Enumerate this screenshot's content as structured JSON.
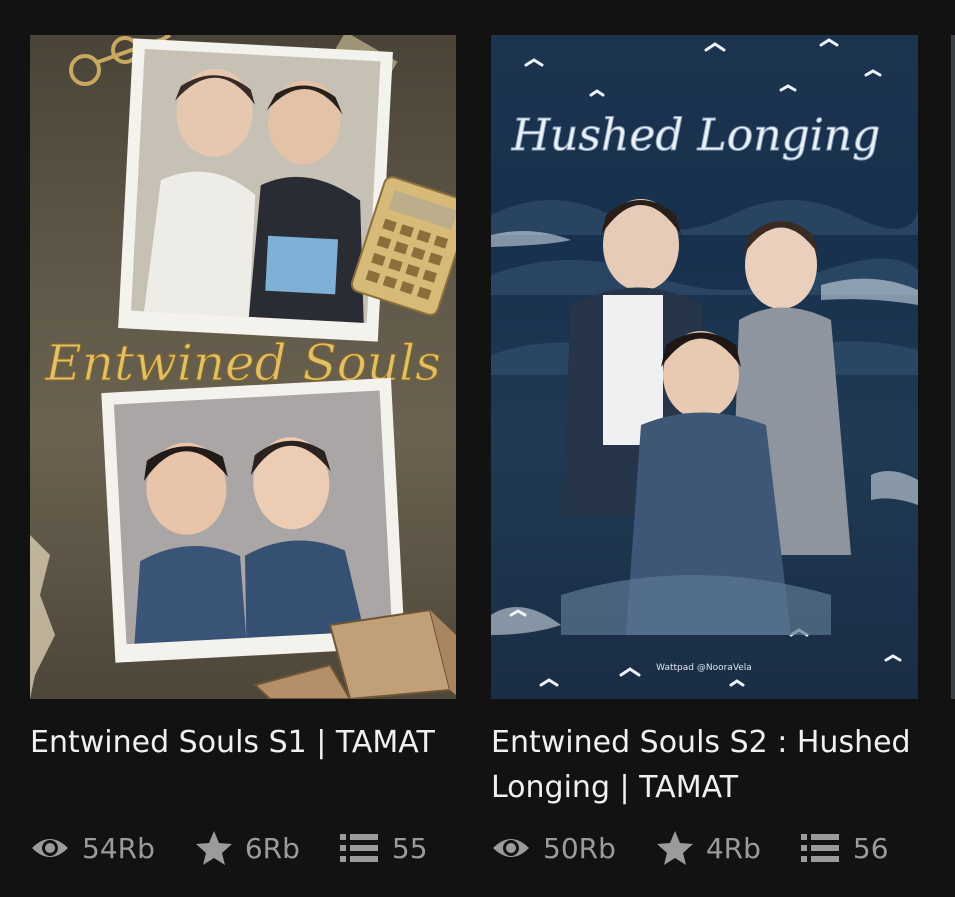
{
  "stories": [
    {
      "cover_lettering": "Entwined Souls",
      "title": "Entwined Souls S1 | TAMAT",
      "reads": "54Rb",
      "votes": "6Rb",
      "parts": "55"
    },
    {
      "cover_lettering": "Hushed Longing",
      "cover_credit": "Wattpad @NooraVela",
      "title": "Entwined Souls S2 : Hushed Longing | TAMAT",
      "reads": "50Rb",
      "votes": "4Rb",
      "parts": "56"
    }
  ],
  "icons": {
    "reads": "eye-icon",
    "votes": "star-icon",
    "parts": "list-icon"
  },
  "colors": {
    "background": "#121212",
    "title_text": "#f0f0f0",
    "stat_text": "#9b9b9b"
  }
}
